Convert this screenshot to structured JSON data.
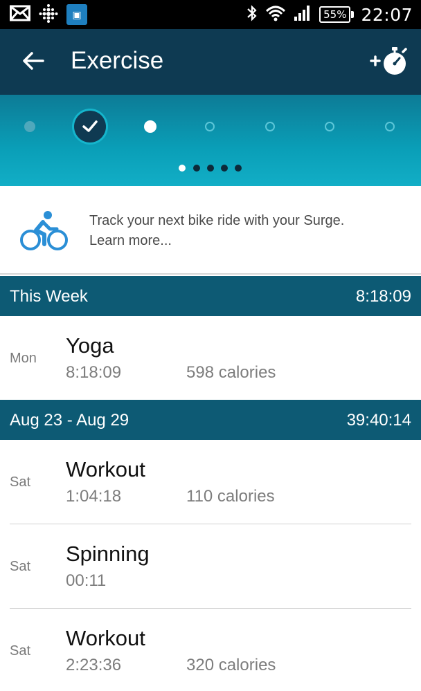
{
  "status_bar": {
    "battery": "55%",
    "time": "22:07",
    "icons": [
      "mail-icon",
      "fitbit-dots-icon",
      "fitbit-app-icon",
      "bluetooth-icon",
      "wifi-icon",
      "signal-icon",
      "battery-icon"
    ]
  },
  "app_bar": {
    "title": "Exercise",
    "back_icon": "arrow-left-icon",
    "action_icon": "add-stopwatch-icon"
  },
  "carousel": {
    "days": [
      {
        "state": "empty"
      },
      {
        "state": "completed"
      },
      {
        "state": "selected"
      },
      {
        "state": "future"
      },
      {
        "state": "future"
      },
      {
        "state": "future"
      },
      {
        "state": "future"
      }
    ],
    "pages": 5,
    "active_page": 1
  },
  "promo": {
    "icon": "bike-icon",
    "line1": "Track your next bike ride with your Surge.",
    "line2": "Learn more..."
  },
  "sections": [
    {
      "label": "This Week",
      "total": "8:18:09",
      "activities": [
        {
          "day": "Mon",
          "name": "Yoga",
          "duration": "8:18:09",
          "calories": "598 calories"
        }
      ]
    },
    {
      "label": "Aug 23 - Aug 29",
      "total": "39:40:14",
      "activities": [
        {
          "day": "Sat",
          "name": "Workout",
          "duration": "1:04:18",
          "calories": "110 calories"
        },
        {
          "day": "Sat",
          "name": "Spinning",
          "duration": "00:11",
          "calories": ""
        },
        {
          "day": "Sat",
          "name": "Workout",
          "duration": "2:23:36",
          "calories": "320 calories"
        }
      ]
    }
  ],
  "colors": {
    "app_bar": "#0e3a52",
    "section_header": "#0d5a74",
    "carousel": "#0a9fb8",
    "accent_blue": "#2b8fd6"
  }
}
